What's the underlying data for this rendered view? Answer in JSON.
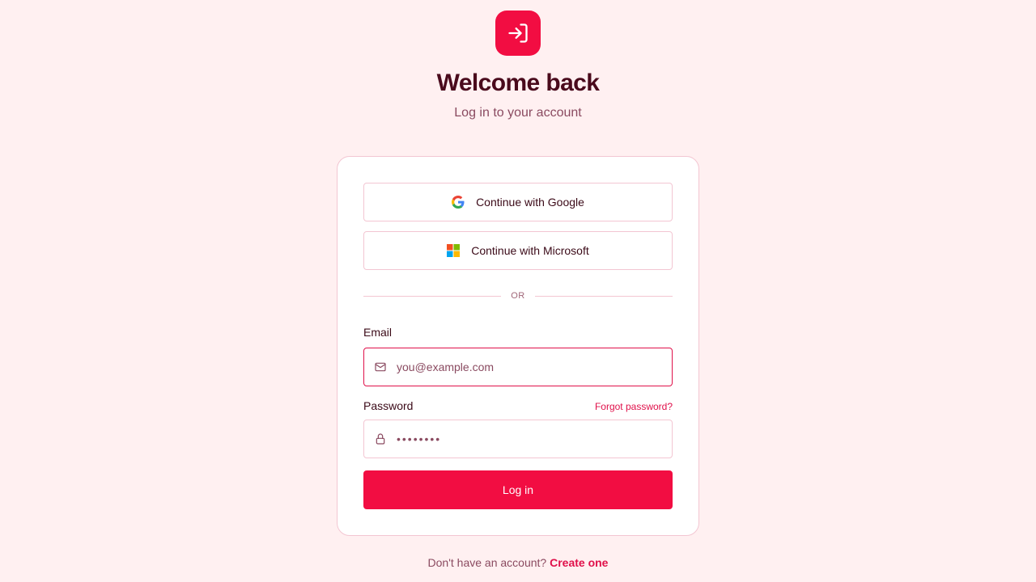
{
  "header": {
    "icon": "login-arrow-icon",
    "title": "Welcome back",
    "subtitle": "Log in to your account"
  },
  "sso": {
    "google_label": "Continue with Google",
    "google_icon": "google-icon",
    "microsoft_label": "Continue with Microsoft",
    "microsoft_icon": "microsoft-icon"
  },
  "divider": {
    "text": "OR"
  },
  "email": {
    "label": "Email",
    "placeholder": "you@example.com",
    "value": "",
    "icon": "mail-icon"
  },
  "password": {
    "label": "Password",
    "forgot_label": "Forgot password?",
    "value": "••••••••",
    "icon": "lock-icon"
  },
  "submit": {
    "label": "Log in"
  },
  "footer": {
    "prompt": "Don't have an account?",
    "link_label": "Create one"
  },
  "colors": {
    "accent": "#f20d42",
    "background": "#fff0f1",
    "border": "#f3c6d2",
    "text": "#4a0a1c"
  }
}
